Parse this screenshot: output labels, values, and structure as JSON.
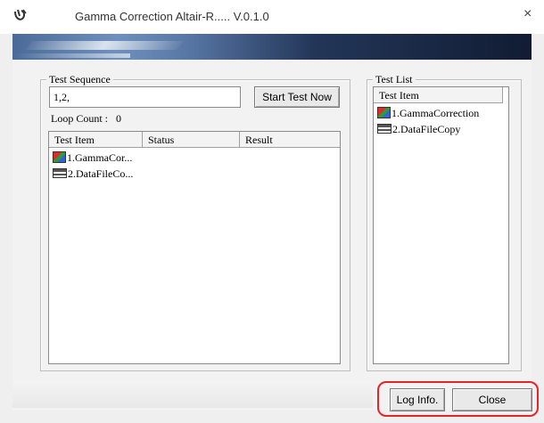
{
  "window": {
    "title": "Gamma Correction Altair-R..... V.0.1.0",
    "close_glyph": "×",
    "icon": "app-logo-icon"
  },
  "test_sequence": {
    "legend": "Test Sequence",
    "sequence_value": "1,2,",
    "start_button": "Start Test Now",
    "loop_count_label": "Loop Count :",
    "loop_count_value": "0",
    "columns": [
      "Test Item",
      "Status",
      "Result"
    ],
    "items": [
      {
        "label": "1.GammaCor...",
        "icon": "gamma-icon"
      },
      {
        "label": "2.DataFileCo...",
        "icon": "data-file-icon"
      }
    ]
  },
  "test_list": {
    "legend": "Test List",
    "column": "Test Item",
    "items": [
      {
        "label": "1.GammaCorrection",
        "icon": "gamma-icon"
      },
      {
        "label": "2.DataFileCopy",
        "icon": "data-file-icon"
      }
    ]
  },
  "footer": {
    "log_button": "Log Info.",
    "close_button": "Close"
  },
  "colors": {
    "highlight": "#e0252b",
    "banner_dark": "#111c33",
    "banner_light": "#6f90bd"
  }
}
